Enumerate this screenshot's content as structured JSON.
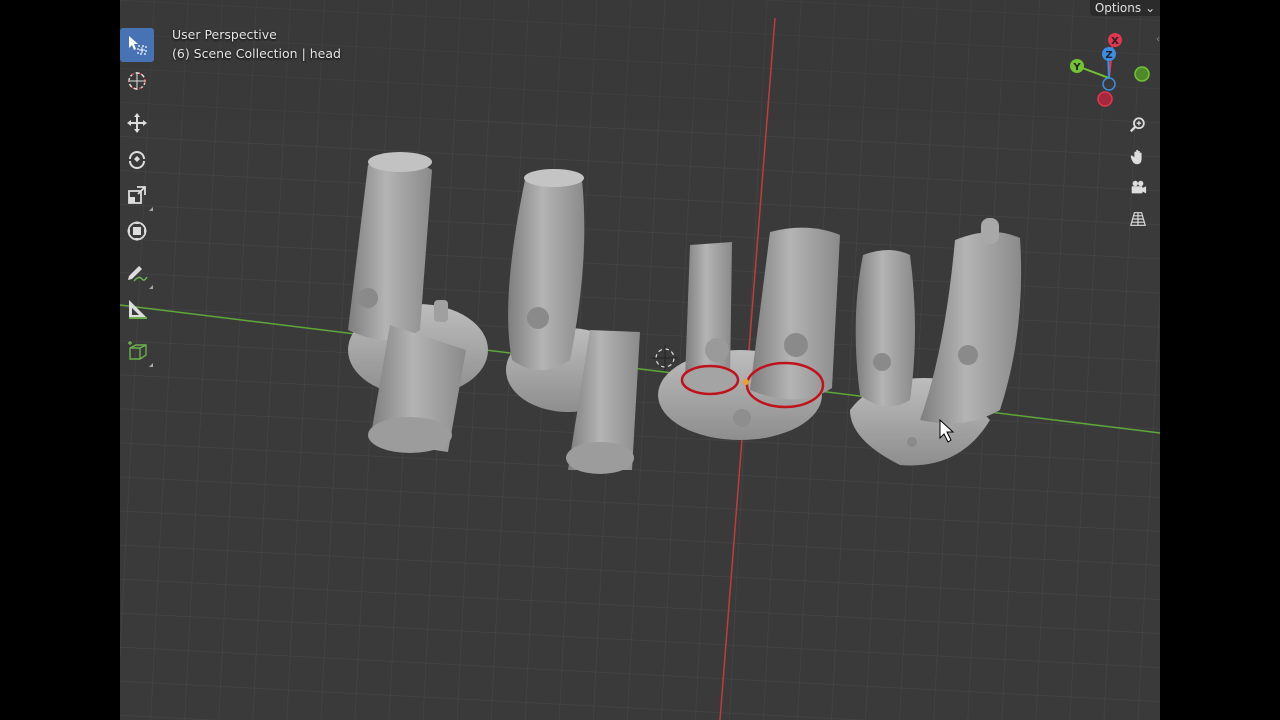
{
  "viewport": {
    "view_name": "User Perspective",
    "collection_info": "(6) Scene Collection | head",
    "options_label": "Options"
  },
  "gizmo": {
    "x_label": "X",
    "y_label": "Y",
    "z_label": "Z",
    "colors": {
      "x": "#e0364f",
      "y": "#73c335",
      "z": "#3b8ee3"
    }
  },
  "toolbar": {
    "tools": [
      "select-box",
      "cursor",
      "move",
      "rotate",
      "scale",
      "transform",
      "annotate",
      "measure",
      "add-cube"
    ],
    "active": "select-box"
  },
  "navigation": [
    "zoom",
    "pan",
    "camera",
    "ortho-toggle"
  ],
  "colors": {
    "viewport_bg": "#3a3a3a",
    "grid": "#474747",
    "x_axis": "#c0392b",
    "y_axis": "#6ab04c",
    "model": "#a4a4a4",
    "selection": "#c0121b",
    "active_tool": "#4772b3"
  }
}
